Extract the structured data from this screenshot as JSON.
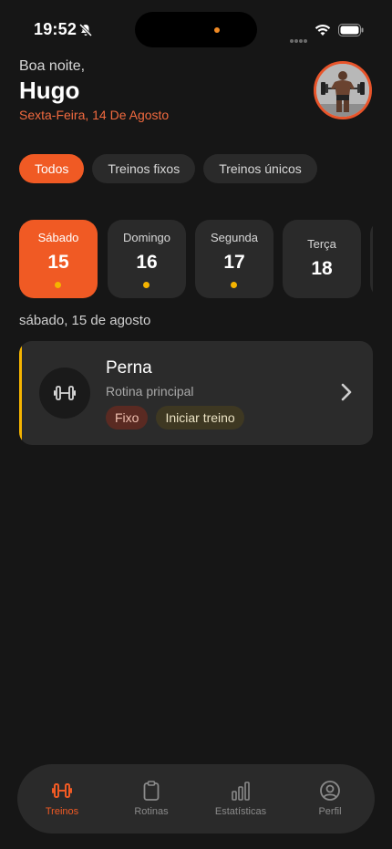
{
  "status_bar": {
    "time": "19:52"
  },
  "header": {
    "greeting": "Boa noite,",
    "name": "Hugo",
    "date": "Sexta-Feira, 14 De Agosto"
  },
  "filters": [
    {
      "label": "Todos",
      "active": true
    },
    {
      "label": "Treinos fixos",
      "active": false
    },
    {
      "label": "Treinos únicos",
      "active": false
    }
  ],
  "days": [
    {
      "name": "Sábado",
      "number": "15",
      "has_dot": true,
      "active": true
    },
    {
      "name": "Domingo",
      "number": "16",
      "has_dot": true,
      "active": false
    },
    {
      "name": "Segunda",
      "number": "17",
      "has_dot": true,
      "active": false
    },
    {
      "name": "Terça",
      "number": "18",
      "has_dot": false,
      "active": false
    }
  ],
  "selected_date": "sábado, 15 de agosto",
  "workout": {
    "title": "Perna",
    "subtitle": "Rotina principal",
    "tag_type": "Fixo",
    "action": "Iniciar treino",
    "icon": "dumbbell-icon"
  },
  "nav": [
    {
      "label": "Treinos",
      "icon": "dumbbell-icon",
      "active": true
    },
    {
      "label": "Rotinas",
      "icon": "clipboard-icon",
      "active": false
    },
    {
      "label": "Estatísticas",
      "icon": "bar-chart-icon",
      "active": false
    },
    {
      "label": "Perfil",
      "icon": "user-circle-icon",
      "active": false
    }
  ],
  "colors": {
    "accent": "#f05a24",
    "dot": "#f5b400",
    "background": "#161616",
    "card": "#2b2b2b"
  }
}
